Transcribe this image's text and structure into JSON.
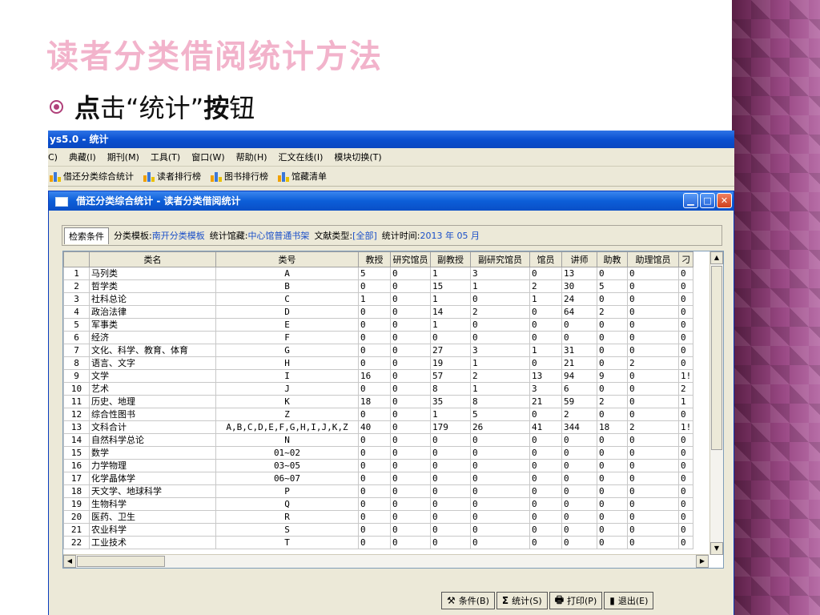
{
  "slide": {
    "title": "读者分类借阅统计方法",
    "bullet_bold": "点",
    "bullet_rest": "击“统计”",
    "bullet_bold2": "按",
    "bullet_end": "钮"
  },
  "app": {
    "title": "ys5.0 - 统计",
    "menus": [
      "C)",
      "典藏(I)",
      "期刊(M)",
      "工具(T)",
      "窗口(W)",
      "帮助(H)",
      "汇文在线(I)",
      "模块切换(T)"
    ],
    "toolbar": [
      "借还分类综合统计",
      "读者排行榜",
      "图书排行榜",
      "馆藏清单"
    ]
  },
  "child": {
    "title": "借还分类综合统计 - 读者分类借阅统计",
    "filter": {
      "tab": "检索条件",
      "template_label": "分类模板:",
      "template_value": "南开分类模板",
      "library_label": "统计馆藏:",
      "library_value": "中心馆普通书架",
      "doctype_label": "文献类型:",
      "doctype_value": "[全部]",
      "time_label": "统计时间:",
      "time_value": "2013 年 05 月"
    },
    "columns": [
      "",
      "类名",
      "类号",
      "教授",
      "研究馆员",
      "副教授",
      "副研究馆员",
      "馆员",
      "讲师",
      "助教",
      "助理馆员",
      "刁"
    ],
    "rows": [
      [
        "1",
        "马列类",
        "A",
        "5",
        "0",
        "1",
        "3",
        "0",
        "13",
        "0",
        "0",
        "0"
      ],
      [
        "2",
        "哲学类",
        "B",
        "0",
        "0",
        "15",
        "1",
        "2",
        "30",
        "5",
        "0",
        "0"
      ],
      [
        "3",
        "社科总论",
        "C",
        "1",
        "0",
        "1",
        "0",
        "1",
        "24",
        "0",
        "0",
        "0"
      ],
      [
        "4",
        "政治法律",
        "D",
        "0",
        "0",
        "14",
        "2",
        "0",
        "64",
        "2",
        "0",
        "0"
      ],
      [
        "5",
        "军事类",
        "E",
        "0",
        "0",
        "1",
        "0",
        "0",
        "0",
        "0",
        "0",
        "0"
      ],
      [
        "6",
        "经济",
        "F",
        "0",
        "0",
        "0",
        "0",
        "0",
        "0",
        "0",
        "0",
        "0"
      ],
      [
        "7",
        "文化、科学、教育、体育",
        "G",
        "0",
        "0",
        "27",
        "3",
        "1",
        "31",
        "0",
        "0",
        "0"
      ],
      [
        "8",
        "语言、文字",
        "H",
        "0",
        "0",
        "19",
        "1",
        "0",
        "21",
        "0",
        "2",
        "0"
      ],
      [
        "9",
        "文学",
        "I",
        "16",
        "0",
        "57",
        "2",
        "13",
        "94",
        "9",
        "0",
        "1!"
      ],
      [
        "10",
        "艺术",
        "J",
        "0",
        "0",
        "8",
        "1",
        "3",
        "6",
        "0",
        "0",
        "2"
      ],
      [
        "11",
        "历史、地理",
        "K",
        "18",
        "0",
        "35",
        "8",
        "21",
        "59",
        "2",
        "0",
        "1"
      ],
      [
        "12",
        "综合性图书",
        "Z",
        "0",
        "0",
        "1",
        "5",
        "0",
        "2",
        "0",
        "0",
        "0"
      ],
      [
        "13",
        "文科合计",
        "A,B,C,D,E,F,G,H,I,J,K,Z",
        "40",
        "0",
        "179",
        "26",
        "41",
        "344",
        "18",
        "2",
        "1!"
      ],
      [
        "14",
        "自然科学总论",
        "N",
        "0",
        "0",
        "0",
        "0",
        "0",
        "0",
        "0",
        "0",
        "0"
      ],
      [
        "15",
        "数学",
        "01~02",
        "0",
        "0",
        "0",
        "0",
        "0",
        "0",
        "0",
        "0",
        "0"
      ],
      [
        "16",
        "力学物理",
        "03~05",
        "0",
        "0",
        "0",
        "0",
        "0",
        "0",
        "0",
        "0",
        "0"
      ],
      [
        "17",
        "化学晶体学",
        "06~07",
        "0",
        "0",
        "0",
        "0",
        "0",
        "0",
        "0",
        "0",
        "0"
      ],
      [
        "18",
        "天文学、地球科学",
        "P",
        "0",
        "0",
        "0",
        "0",
        "0",
        "0",
        "0",
        "0",
        "0"
      ],
      [
        "19",
        "生物科学",
        "Q",
        "0",
        "0",
        "0",
        "0",
        "0",
        "0",
        "0",
        "0",
        "0"
      ],
      [
        "20",
        "医药、卫生",
        "R",
        "0",
        "0",
        "0",
        "0",
        "0",
        "0",
        "0",
        "0",
        "0"
      ],
      [
        "21",
        "农业科学",
        "S",
        "0",
        "0",
        "0",
        "0",
        "0",
        "0",
        "0",
        "0",
        "0"
      ],
      [
        "22",
        "工业技术",
        "T",
        "0",
        "0",
        "0",
        "0",
        "0",
        "0",
        "0",
        "0",
        "0"
      ]
    ],
    "buttons": [
      {
        "icon": "tools-icon",
        "glyph": "⚒",
        "label": "条件(B)"
      },
      {
        "icon": "sigma-icon",
        "glyph": "Σ",
        "label": "统计(S)"
      },
      {
        "icon": "printer-icon",
        "glyph": "🖶",
        "label": "打印(P)"
      },
      {
        "icon": "exit-icon",
        "glyph": "▮",
        "label": "退出(E)"
      }
    ]
  }
}
